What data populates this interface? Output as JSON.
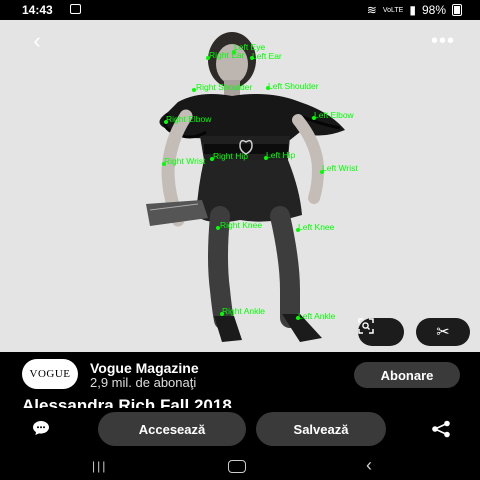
{
  "status_bar": {
    "time": "14:43",
    "battery": "98%",
    "network": "VoLTE"
  },
  "keypoints": [
    {
      "label": "Left Eye"
    },
    {
      "label": "Right Ear"
    },
    {
      "label": "Left Ear"
    },
    {
      "label": "Right Shoulder"
    },
    {
      "label": "Left Shoulder"
    },
    {
      "label": "Right Elbow"
    },
    {
      "label": "Left Elbow"
    },
    {
      "label": "Right Wrist"
    },
    {
      "label": "Right Hip"
    },
    {
      "label": "Left Hip"
    },
    {
      "label": "Left Wrist"
    },
    {
      "label": "Right Knee"
    },
    {
      "label": "Left Knee"
    },
    {
      "label": "Right Ankle"
    },
    {
      "label": "Left Ankle"
    }
  ],
  "channel": {
    "logo_text": "VOGUE",
    "name": "Vogue Magazine",
    "subscribers": "2,9 mil. de abonaţi",
    "subscribe_label": "Abonare"
  },
  "pin_title": "Alessandra Rich Fall 2018",
  "actions": {
    "visit_label": "Accesează",
    "save_label": "Salvează"
  },
  "colors": {
    "keypoint": "#00ff00",
    "button_bg": "#3a3a3a"
  },
  "icons": {
    "back": "back-arrow-icon",
    "more": "more-dots-icon",
    "lens": "visual-search-icon",
    "cut": "scissors-icon",
    "comment": "comment-icon",
    "share": "share-icon"
  }
}
